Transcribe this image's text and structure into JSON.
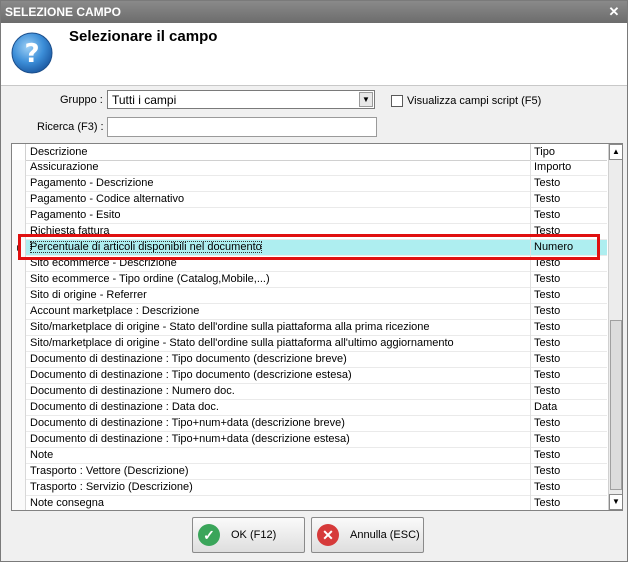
{
  "window": {
    "title": "SELEZIONE CAMPO",
    "close_glyph": "✕"
  },
  "header": {
    "title": "Selezionare il campo",
    "icon": "help-icon"
  },
  "form": {
    "group_label": "Gruppo :",
    "group_value": "Tutti i campi",
    "search_label": "Ricerca (F3) :",
    "search_value": "",
    "script_checkbox_label": "Visualizza campi script (F5)",
    "script_checkbox_checked": false
  },
  "grid": {
    "columns": {
      "description": "Descrizione",
      "type": "Tipo"
    },
    "selected_index": 5,
    "rows": [
      {
        "description": "Assicurazione",
        "type": "Importo"
      },
      {
        "description": "Pagamento - Descrizione",
        "type": "Testo"
      },
      {
        "description": "Pagamento - Codice alternativo",
        "type": "Testo"
      },
      {
        "description": "Pagamento - Esito",
        "type": "Testo"
      },
      {
        "description": "Richiesta fattura",
        "type": "Testo"
      },
      {
        "description": "Percentuale di articoli disponibili nel documento",
        "type": "Numero"
      },
      {
        "description": "Sito ecommerce - Descrizione",
        "type": "Testo"
      },
      {
        "description": "Sito ecommerce - Tipo ordine (Catalog,Mobile,...)",
        "type": "Testo"
      },
      {
        "description": "Sito di origine - Referrer",
        "type": "Testo"
      },
      {
        "description": "Account marketplace : Descrizione",
        "type": "Testo"
      },
      {
        "description": "Sito/marketplace di origine - Stato dell'ordine sulla piattaforma alla prima ricezione",
        "type": "Testo"
      },
      {
        "description": "Sito/marketplace di origine - Stato dell'ordine sulla piattaforma all'ultimo aggiornamento",
        "type": "Testo"
      },
      {
        "description": "Documento di destinazione : Tipo documento (descrizione breve)",
        "type": "Testo"
      },
      {
        "description": "Documento di destinazione : Tipo documento (descrizione estesa)",
        "type": "Testo"
      },
      {
        "description": "Documento di destinazione : Numero doc.",
        "type": "Testo"
      },
      {
        "description": "Documento di destinazione : Data doc.",
        "type": "Data"
      },
      {
        "description": "Documento di destinazione : Tipo+num+data (descrizione breve)",
        "type": "Testo"
      },
      {
        "description": "Documento di destinazione : Tipo+num+data (descrizione estesa)",
        "type": "Testo"
      },
      {
        "description": "Note",
        "type": "Testo"
      },
      {
        "description": "Trasporto : Vettore (Descrizione)",
        "type": "Testo"
      },
      {
        "description": "Trasporto : Servizio (Descrizione)",
        "type": "Testo"
      },
      {
        "description": "Note consegna",
        "type": "Testo"
      }
    ]
  },
  "buttons": {
    "ok": {
      "label": "OK (F12)",
      "icon": "check-icon",
      "color": "#3aa55a"
    },
    "cancel": {
      "label": "Annulla (ESC)",
      "icon": "cancel-icon",
      "color": "#d63a3a"
    }
  },
  "colors": {
    "selection": "#aeeef0",
    "highlight_border": "#e01010"
  }
}
